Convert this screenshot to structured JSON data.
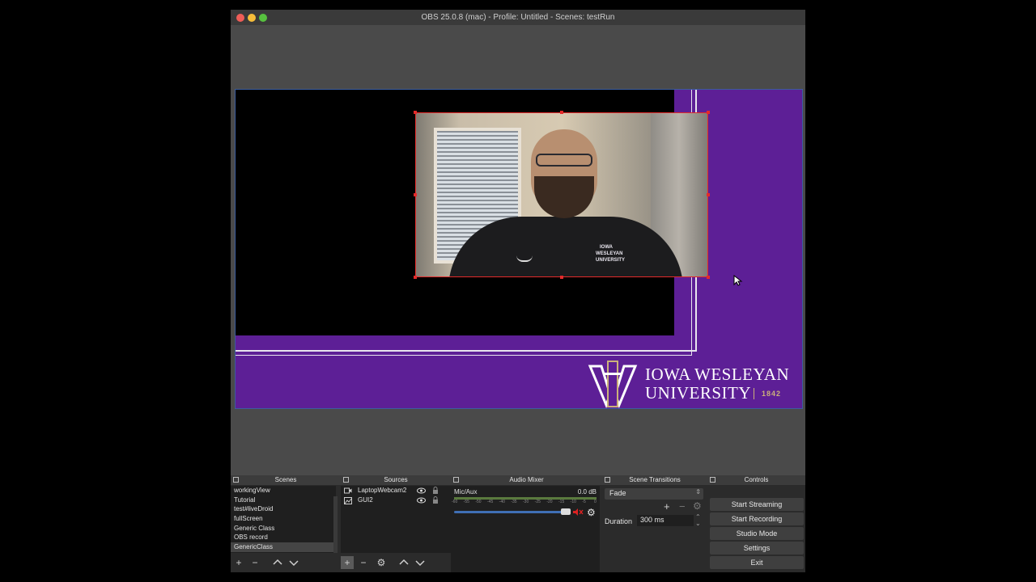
{
  "window": {
    "title": "OBS 25.0.8 (mac) - Profile: Untitled - Scenes: testRun"
  },
  "brand": {
    "line1": "IOWA WESLEYAN",
    "line2": "UNIVERSITY",
    "year": "1842",
    "cam_logo": "IOWA WESLEYAN UNIVERSITY",
    "primary_color": "#5d1f96",
    "gold_color": "#cbb17a"
  },
  "docks": {
    "scenes": {
      "title": "Scenes",
      "items": [
        "workingView",
        "Tutorial",
        "test#liveDroid",
        "fullScreen",
        "Generic Class",
        "OBS record",
        "GenericClass"
      ],
      "selected_index": 6
    },
    "sources": {
      "title": "Sources",
      "items": [
        {
          "name": "LaptopWebcam2",
          "icon": "camera-icon"
        },
        {
          "name": "GUI2",
          "icon": "image-icon"
        }
      ]
    },
    "mixer": {
      "title": "Audio Mixer",
      "channel": "Mic/Aux",
      "level": "0.0 dB",
      "ticks": [
        "-60",
        "-55",
        "-50",
        "-45",
        "-40",
        "-35",
        "-30",
        "-25",
        "-20",
        "-15",
        "-10",
        "-5",
        "0"
      ],
      "volume_fraction": 1.0,
      "muted": true
    },
    "transitions": {
      "title": "Scene Transitions",
      "selected": "Fade",
      "duration_label": "Duration",
      "duration_value": "300 ms"
    },
    "controls": {
      "title": "Controls",
      "buttons": [
        "Start Streaming",
        "Start Recording",
        "Studio Mode",
        "Settings",
        "Exit"
      ]
    }
  }
}
